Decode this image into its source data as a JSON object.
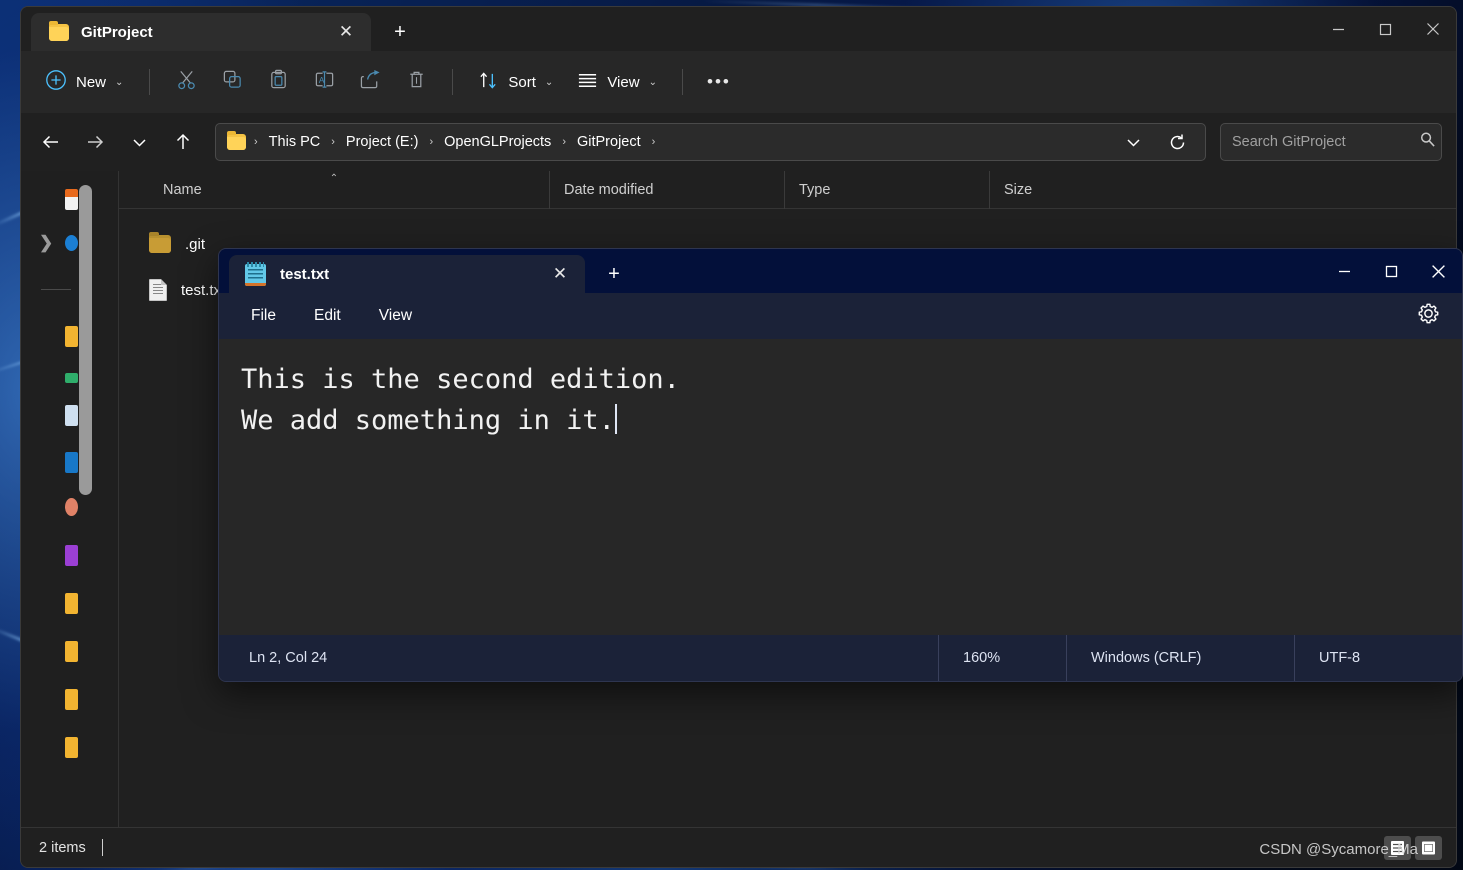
{
  "explorer": {
    "tab": {
      "title": "GitProject",
      "icon": "folder-icon",
      "close_label": "✕",
      "new_tab_label": "+"
    },
    "window_controls": {
      "minimize": "minimize-icon",
      "maximize": "maximize-icon",
      "close": "close-icon"
    },
    "toolbar": {
      "new_label": "New",
      "new_icon": "plus-circle-icon",
      "cut_icon": "scissors-icon",
      "copy_icon": "copy-icon",
      "paste_icon": "paste-icon",
      "rename_icon": "rename-icon",
      "share_icon": "share-icon",
      "delete_icon": "trash-icon",
      "sort_label": "Sort",
      "sort_icon": "sort-arrows-icon",
      "view_label": "View",
      "view_icon": "list-lines-icon",
      "more_label": "•••"
    },
    "nav": {
      "back_icon": "arrow-left-icon",
      "forward_icon": "arrow-right-icon",
      "recent_icon": "chevron-down-icon",
      "up_icon": "arrow-up-icon",
      "refresh_icon": "refresh-icon",
      "dropdown_icon": "chevron-down-icon"
    },
    "breadcrumb": {
      "folder_icon": "folder-icon",
      "items": [
        "This PC",
        "Project (E:)",
        "OpenGLProjects",
        "GitProject"
      ],
      "separator": "›"
    },
    "search": {
      "placeholder": "Search GitProject",
      "value": "",
      "icon": "search-icon"
    },
    "columns": [
      {
        "label": "Name",
        "sorted": true,
        "sort_caret": "⌃"
      },
      {
        "label": "Date modified"
      },
      {
        "label": "Type"
      },
      {
        "label": "Size"
      }
    ],
    "files": [
      {
        "name": ".git",
        "icon": "folder-icon",
        "date_modified": "",
        "type": "",
        "size": ""
      },
      {
        "name": "test.txt",
        "icon": "text-file-icon",
        "date_modified": "",
        "type": "",
        "size": ""
      }
    ],
    "status": {
      "item_count": "2 items",
      "details_view_icon": "details-view-icon",
      "large_icons_view_icon": "large-icons-view-icon"
    },
    "watermark": "CSDN @Sycamore_Ma"
  },
  "notepad": {
    "tab": {
      "title": "test.txt",
      "icon": "notepad-icon",
      "close_label": "✕",
      "new_tab_label": "+"
    },
    "window_controls": {
      "minimize": "minimize-icon",
      "maximize": "maximize-icon",
      "close": "close-icon"
    },
    "menus": [
      "File",
      "Edit",
      "View"
    ],
    "settings_icon": "gear-icon",
    "document": {
      "lines": [
        "This is the second edition.",
        "We add something in it."
      ]
    },
    "status": {
      "position": "Ln 2, Col 24",
      "zoom": "160%",
      "line_ending": "Windows (CRLF)",
      "encoding": "UTF-8"
    }
  },
  "colors": {
    "explorer_bg": "#202020",
    "explorer_toolbar": "#272727",
    "notepad_chrome": "#1b2238",
    "notepad_titlebar": "#03103a",
    "notepad_editor": "#272727",
    "accent_blue": "#4cc2ff",
    "folder_yellow": "#ffd358"
  }
}
